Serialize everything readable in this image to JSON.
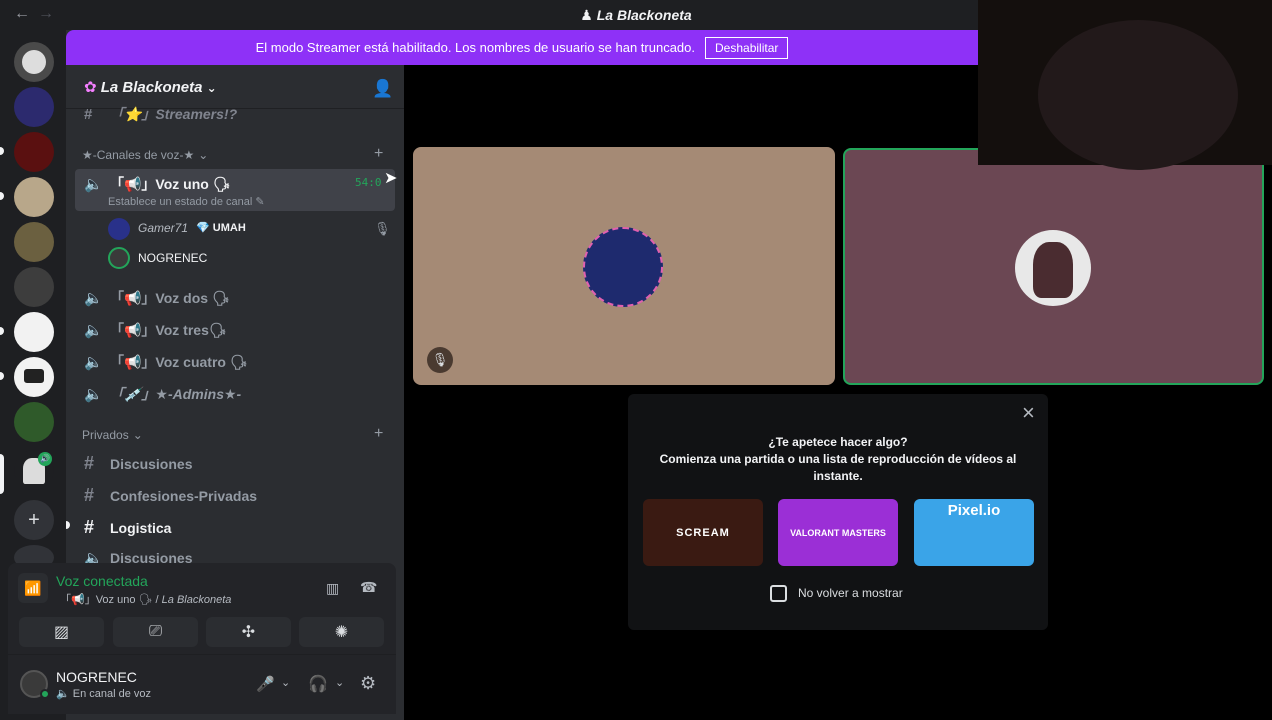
{
  "titlebar": {
    "title": "La Blackoneta",
    "back": "←",
    "forward": "→"
  },
  "banner": {
    "text": "El modo Streamer está habilitado. Los nombres de usuario se han truncado.",
    "button": "Deshabilitar"
  },
  "server": {
    "name": "La Blackoneta",
    "chevron": "⌄",
    "invite_icon": "add-member-icon"
  },
  "channels_top": {
    "partial_channel": "「⭐」Streamers!?"
  },
  "voice_category": {
    "label": "★-Canales de voz-★",
    "chevron": "⌄",
    "add": "+"
  },
  "voice_uno": {
    "name": "「📢」Voz uno 🗣",
    "status": "Establece un estado de canal",
    "timer": "54:0"
  },
  "voice_members": [
    {
      "name": "Gamer71",
      "badge": "UMAH"
    },
    {
      "name": "NOGRENEC"
    }
  ],
  "voice_channels": [
    {
      "name": "「📢」Voz dos 🗣"
    },
    {
      "name": "「📢」Voz tres🗣"
    },
    {
      "name": "「📢」Voz cuatro 🗣"
    },
    {
      "name": "「💉」★-Admins★-"
    }
  ],
  "private_category": {
    "label": "Privados",
    "chevron": "⌄",
    "add": "+"
  },
  "private_channels": [
    {
      "name": "Discusiones",
      "bold": false
    },
    {
      "name": "Confesiones-Privadas",
      "bold": false
    },
    {
      "name": "Logistica",
      "bold": true
    },
    {
      "name": "Discusiones",
      "bold": false
    }
  ],
  "voice_connection": {
    "status": "Voz conectada",
    "detail_channel": "「📢」Voz uno 🗣 /",
    "detail_server": "La Blackoneta"
  },
  "user": {
    "name": "NOGRENEC",
    "status": "En canal de voz"
  },
  "activity_panel": {
    "question": "¿Te apetece hacer algo?",
    "description": "Comienza una partida o una lista de reproducción de vídeos al instante.",
    "games": [
      {
        "label": "SCREAM",
        "color": "#3a1a12"
      },
      {
        "label": "VALORANT MASTERS",
        "color": "#9b2fd6"
      },
      {
        "label": "Pixel.io",
        "color": "#3aa4e8"
      }
    ],
    "checkbox_label": "No volver a mostrar",
    "close": "×"
  },
  "colors": {
    "accent": "#8e31f7",
    "green": "#23a55a",
    "tile1": "#a58a75",
    "tile2": "#6b4753"
  }
}
